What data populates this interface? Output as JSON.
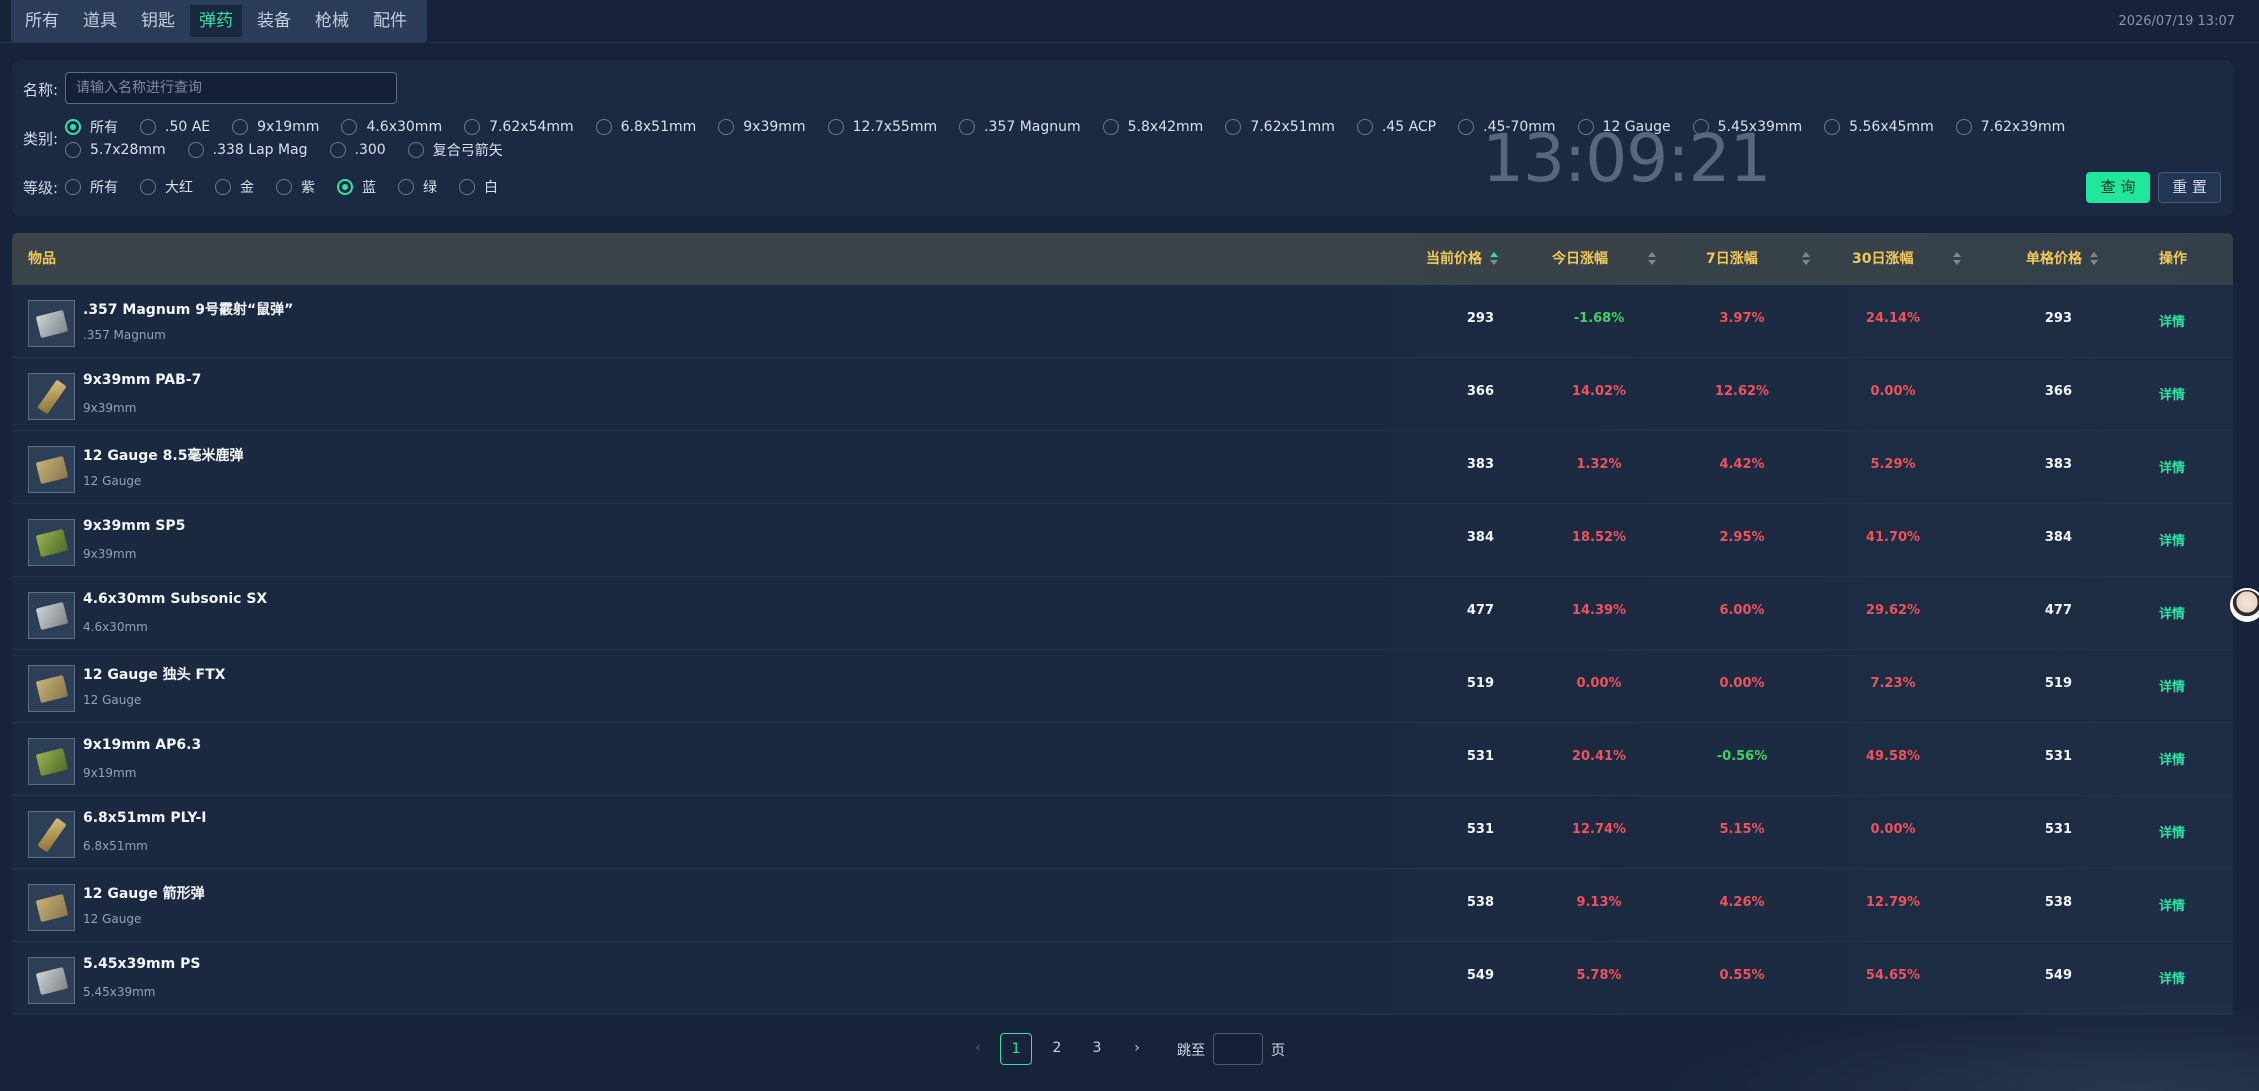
{
  "tabs": [
    {
      "label": "所有",
      "active": false
    },
    {
      "label": "道具",
      "active": false
    },
    {
      "label": "钥匙",
      "active": false
    },
    {
      "label": "弹药",
      "active": true
    },
    {
      "label": "装备",
      "active": false
    },
    {
      "label": "枪械",
      "active": false
    },
    {
      "label": "配件",
      "active": false
    }
  ],
  "datetime": "2026/07/19 13:07",
  "filter": {
    "name_label": "名称:",
    "name_placeholder": "请输入名称进行查询",
    "name_value": "",
    "category_label": "类别:",
    "categories": [
      {
        "label": "所有",
        "checked": true
      },
      {
        "label": ".50 AE",
        "checked": false
      },
      {
        "label": "9x19mm",
        "checked": false
      },
      {
        "label": "4.6x30mm",
        "checked": false
      },
      {
        "label": "7.62x54mm",
        "checked": false
      },
      {
        "label": "6.8x51mm",
        "checked": false
      },
      {
        "label": "9x39mm",
        "checked": false
      },
      {
        "label": "12.7x55mm",
        "checked": false
      },
      {
        "label": ".357 Magnum",
        "checked": false
      },
      {
        "label": "5.8x42mm",
        "checked": false
      },
      {
        "label": "7.62x51mm",
        "checked": false
      },
      {
        "label": ".45 ACP",
        "checked": false
      },
      {
        "label": ".45-70mm",
        "checked": false
      },
      {
        "label": "12 Gauge",
        "checked": false
      },
      {
        "label": "5.45x39mm",
        "checked": false
      },
      {
        "label": "5.56x45mm",
        "checked": false
      },
      {
        "label": "7.62x39mm",
        "checked": false
      },
      {
        "label": "5.7x28mm",
        "checked": false
      },
      {
        "label": ".338 Lap Mag",
        "checked": false
      },
      {
        "label": ".300",
        "checked": false
      },
      {
        "label": "复合弓箭矢",
        "checked": false
      }
    ],
    "grade_label": "等级:",
    "grades": [
      {
        "label": "所有",
        "checked": false
      },
      {
        "label": "大红",
        "checked": false
      },
      {
        "label": "金",
        "checked": false
      },
      {
        "label": "紫",
        "checked": false
      },
      {
        "label": "蓝",
        "checked": true
      },
      {
        "label": "绿",
        "checked": false
      },
      {
        "label": "白",
        "checked": false
      }
    ],
    "clock": "13:09:21",
    "query_button": "查 询",
    "reset_button": "重 置"
  },
  "table": {
    "columns": {
      "item": "物品",
      "current_price": "当前价格",
      "day1": "今日涨幅",
      "day7": "7日涨幅",
      "day30": "30日涨幅",
      "unit_price": "单格价格",
      "action": "操作"
    },
    "rows": [
      {
        "name": ".357 Magnum 9号霰射“鼠弹”",
        "category": ".357 Magnum",
        "price": "293",
        "d1": "-1.68%",
        "d7": "3.97%",
        "d30": "24.14%",
        "unit": "293",
        "action": "详情",
        "icon": "silver"
      },
      {
        "name": "9x39mm PAB-7",
        "category": "9x39mm",
        "price": "366",
        "d1": "14.02%",
        "d7": "12.62%",
        "d30": "0.00%",
        "unit": "366",
        "action": "详情",
        "icon": "bullet"
      },
      {
        "name": "12 Gauge 8.5毫米鹿弹",
        "category": "12 Gauge",
        "price": "383",
        "d1": "1.32%",
        "d7": "4.42%",
        "d30": "5.29%",
        "unit": "383",
        "action": "详情",
        "icon": "tan"
      },
      {
        "name": "9x39mm SP5",
        "category": "9x39mm",
        "price": "384",
        "d1": "18.52%",
        "d7": "2.95%",
        "d30": "41.70%",
        "unit": "384",
        "action": "详情",
        "icon": "green"
      },
      {
        "name": "4.6x30mm Subsonic SX",
        "category": "4.6x30mm",
        "price": "477",
        "d1": "14.39%",
        "d7": "6.00%",
        "d30": "29.62%",
        "unit": "477",
        "action": "详情",
        "icon": "silver"
      },
      {
        "name": "12 Gauge 独头 FTX",
        "category": "12 Gauge",
        "price": "519",
        "d1": "0.00%",
        "d7": "0.00%",
        "d30": "7.23%",
        "unit": "519",
        "action": "详情",
        "icon": "tan"
      },
      {
        "name": "9x19mm AP6.3",
        "category": "9x19mm",
        "price": "531",
        "d1": "20.41%",
        "d7": "-0.56%",
        "d30": "49.58%",
        "unit": "531",
        "action": "详情",
        "icon": "green"
      },
      {
        "name": "6.8x51mm PLY-I",
        "category": "6.8x51mm",
        "price": "531",
        "d1": "12.74%",
        "d7": "5.15%",
        "d30": "0.00%",
        "unit": "531",
        "action": "详情",
        "icon": "bullet"
      },
      {
        "name": "12 Gauge 箭形弹",
        "category": "12 Gauge",
        "price": "538",
        "d1": "9.13%",
        "d7": "4.26%",
        "d30": "12.79%",
        "unit": "538",
        "action": "详情",
        "icon": "tan"
      },
      {
        "name": "5.45x39mm PS",
        "category": "5.45x39mm",
        "price": "549",
        "d1": "5.78%",
        "d7": "0.55%",
        "d30": "54.65%",
        "unit": "549",
        "action": "详情",
        "icon": "silver"
      }
    ]
  },
  "pagination": {
    "prev": "‹",
    "pages": [
      "1",
      "2",
      "3"
    ],
    "current": "1",
    "next": "›",
    "jump_label": "跳至",
    "jump_suffix": "页",
    "jump_value": ""
  },
  "colors": {
    "accent": "#2ee2a4",
    "header_text": "#f0c95a",
    "up": "#f0525c",
    "down": "#3dd35f"
  }
}
